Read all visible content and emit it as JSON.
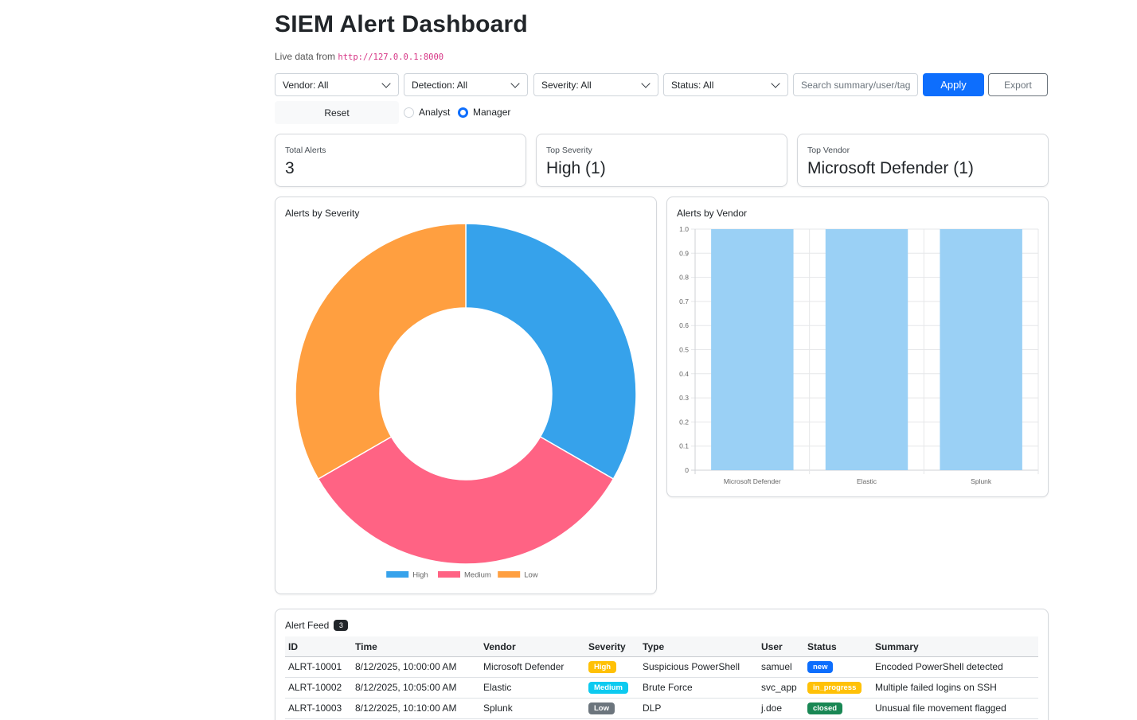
{
  "header": {
    "title": "SIEM Alert Dashboard",
    "subtitle_prefix": "Live data from ",
    "endpoint": "http://127.0.0.1:8000"
  },
  "filters": {
    "vendor": "Vendor: All",
    "detection": "Detection: All",
    "severity": "Severity: All",
    "status": "Status: All",
    "search_placeholder": "Search summary/user/tag",
    "apply_label": "Apply",
    "export_label": "Export",
    "reset_label": "Reset",
    "roles": [
      {
        "label": "Analyst",
        "selected": false
      },
      {
        "label": "Manager",
        "selected": true
      }
    ]
  },
  "kpis": [
    {
      "label": "Total Alerts",
      "value": "3"
    },
    {
      "label": "Top Severity",
      "value": "High (1)"
    },
    {
      "label": "Top Vendor",
      "value": "Microsoft Defender (1)"
    }
  ],
  "chart_data": [
    {
      "type": "pie",
      "title": "Alerts by Severity",
      "categories": [
        "High",
        "Medium",
        "Low"
      ],
      "values": [
        1,
        1,
        1
      ],
      "colors": [
        "#36a2eb",
        "#ff6384",
        "#ff9f40"
      ],
      "legend": "bottom"
    },
    {
      "type": "bar",
      "title": "Alerts by Vendor",
      "categories": [
        "Microsoft Defender",
        "Elastic",
        "Splunk"
      ],
      "values": [
        1,
        1,
        1
      ],
      "ylim": [
        0,
        1.0
      ],
      "yticks": [
        "0",
        "0.1",
        "0.2",
        "0.3",
        "0.4",
        "0.5",
        "0.6",
        "0.7",
        "0.8",
        "0.9",
        "1.0"
      ],
      "color": "#9ad0f5",
      "grid": true
    }
  ],
  "feed": {
    "title": "Alert Feed",
    "count": "3",
    "columns": [
      "ID",
      "Time",
      "Vendor",
      "Severity",
      "Type",
      "User",
      "Status",
      "Summary"
    ],
    "rows": [
      {
        "id": "ALRT-10001",
        "time": "8/12/2025, 10:00:00 AM",
        "vendor": "Microsoft Defender",
        "severity": "High",
        "severity_color": "#ffc107",
        "type": "Suspicious PowerShell",
        "user": "samuel",
        "status": "new",
        "status_color": "#0d6efd",
        "summary": "Encoded PowerShell detected"
      },
      {
        "id": "ALRT-10002",
        "time": "8/12/2025, 10:05:00 AM",
        "vendor": "Elastic",
        "severity": "Medium",
        "severity_color": "#0dcaf0",
        "type": "Brute Force",
        "user": "svc_app",
        "status": "in_progress",
        "status_color": "#ffc107",
        "summary": "Multiple failed logins on SSH"
      },
      {
        "id": "ALRT-10003",
        "time": "8/12/2025, 10:10:00 AM",
        "vendor": "Splunk",
        "severity": "Low",
        "severity_color": "#6c757d",
        "type": "DLP",
        "user": "j.doe",
        "status": "closed",
        "status_color": "#198754",
        "summary": "Unusual file movement flagged"
      }
    ]
  }
}
